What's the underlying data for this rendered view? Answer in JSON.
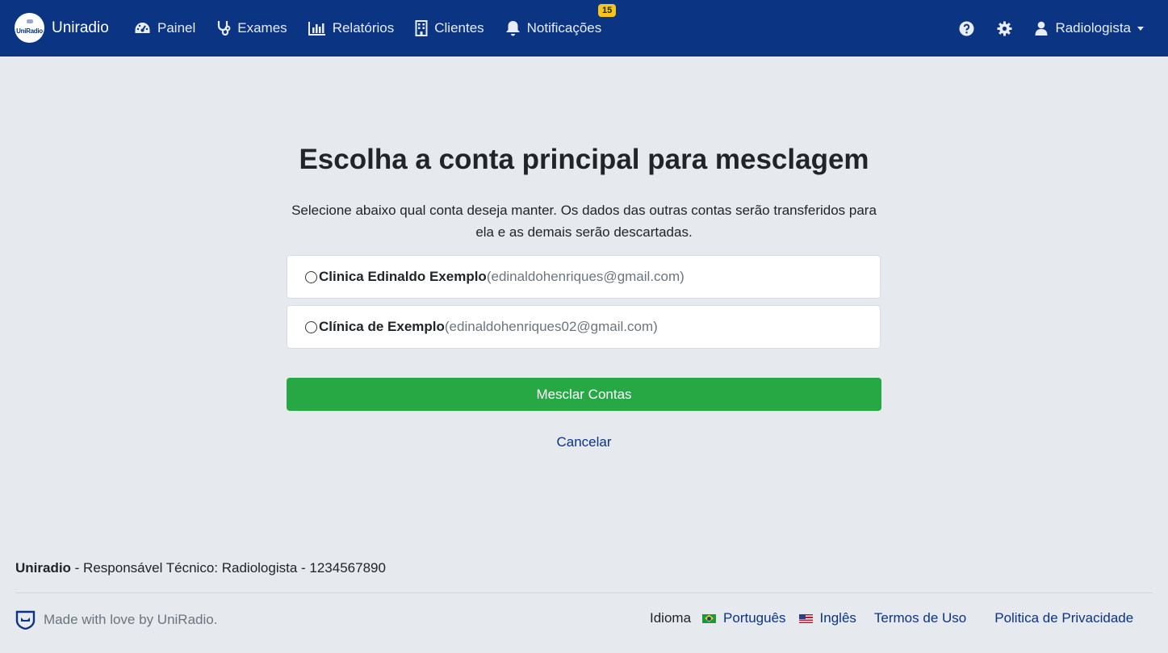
{
  "navbar": {
    "brand": "Uniradio",
    "logo_text": "UniRadio",
    "items": [
      {
        "label": "Painel",
        "icon": "dashboard-icon"
      },
      {
        "label": "Exames",
        "icon": "stethoscope-icon"
      },
      {
        "label": "Relatórios",
        "icon": "bar-chart-icon"
      },
      {
        "label": "Clientes",
        "icon": "building-icon"
      },
      {
        "label": "Notificações",
        "icon": "bell-icon",
        "badge": "15"
      }
    ],
    "user": "Radiologista",
    "colors": {
      "background": "#0b3582",
      "badge": "#f5c518"
    }
  },
  "main": {
    "title": "Escolha a conta principal para mesclagem",
    "description": "Selecione abaixo qual conta deseja manter. Os dados das outras contas serão transferidos para ela e as demais serão descartadas.",
    "accounts": [
      {
        "name": "Clinica Edinaldo Exemplo",
        "email": "(edinaldohenriques@gmail.com)",
        "selected": false
      },
      {
        "name": "Clínica de Exemplo",
        "email": "(edinaldohenriques02@gmail.com)",
        "selected": false
      }
    ],
    "merge_button": "Mesclar Contas",
    "cancel_link": "Cancelar",
    "colors": {
      "merge_button": "#28a745"
    }
  },
  "footer": {
    "brand": "Uniradio",
    "responsible": " - Responsável Técnico: Radiologista - 1234567890",
    "made_with": "Made with love by UniRadio.",
    "language_label": "Idioma",
    "languages": [
      "Português",
      "Inglês"
    ],
    "terms": "Termos de Uso",
    "privacy": "Politica de Privacidade"
  }
}
